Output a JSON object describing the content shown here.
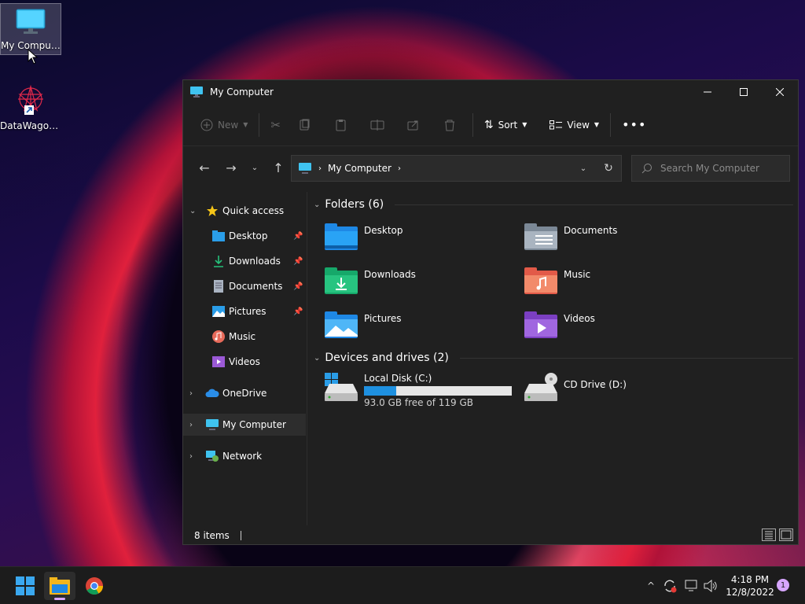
{
  "desktop": {
    "icons": [
      {
        "label": "My Computer"
      },
      {
        "label": "DataWagon..."
      }
    ]
  },
  "window": {
    "title": "My Computer",
    "toolbar": {
      "new_label": "New",
      "sort_label": "Sort",
      "view_label": "View"
    },
    "address": {
      "crumb": "My Computer"
    },
    "search": {
      "placeholder": "Search My Computer"
    },
    "sidebar": {
      "quick_access": "Quick access",
      "items": [
        {
          "label": "Desktop",
          "pinned": true
        },
        {
          "label": "Downloads",
          "pinned": true
        },
        {
          "label": "Documents",
          "pinned": true
        },
        {
          "label": "Pictures",
          "pinned": true
        },
        {
          "label": "Music",
          "pinned": false
        },
        {
          "label": "Videos",
          "pinned": false
        }
      ],
      "onedrive": "OneDrive",
      "mycomputer": "My Computer",
      "network": "Network"
    },
    "folders": {
      "header": "Folders (6)",
      "items": [
        "Desktop",
        "Documents",
        "Downloads",
        "Music",
        "Pictures",
        "Videos"
      ]
    },
    "drives": {
      "header": "Devices and drives (2)",
      "items": [
        {
          "name": "Local Disk (C:)",
          "free": "93.0 GB free of 119 GB",
          "used_fraction": 0.22
        },
        {
          "name": "CD Drive (D:)"
        }
      ]
    },
    "status": {
      "count": "8 items"
    }
  },
  "taskbar": {
    "time": "4:18 PM",
    "date": "12/8/2022",
    "notifications": "1"
  },
  "colors": {
    "accent": "#0a84d6",
    "drive_bar": "#1e90e0",
    "window_bg": "#202020"
  }
}
